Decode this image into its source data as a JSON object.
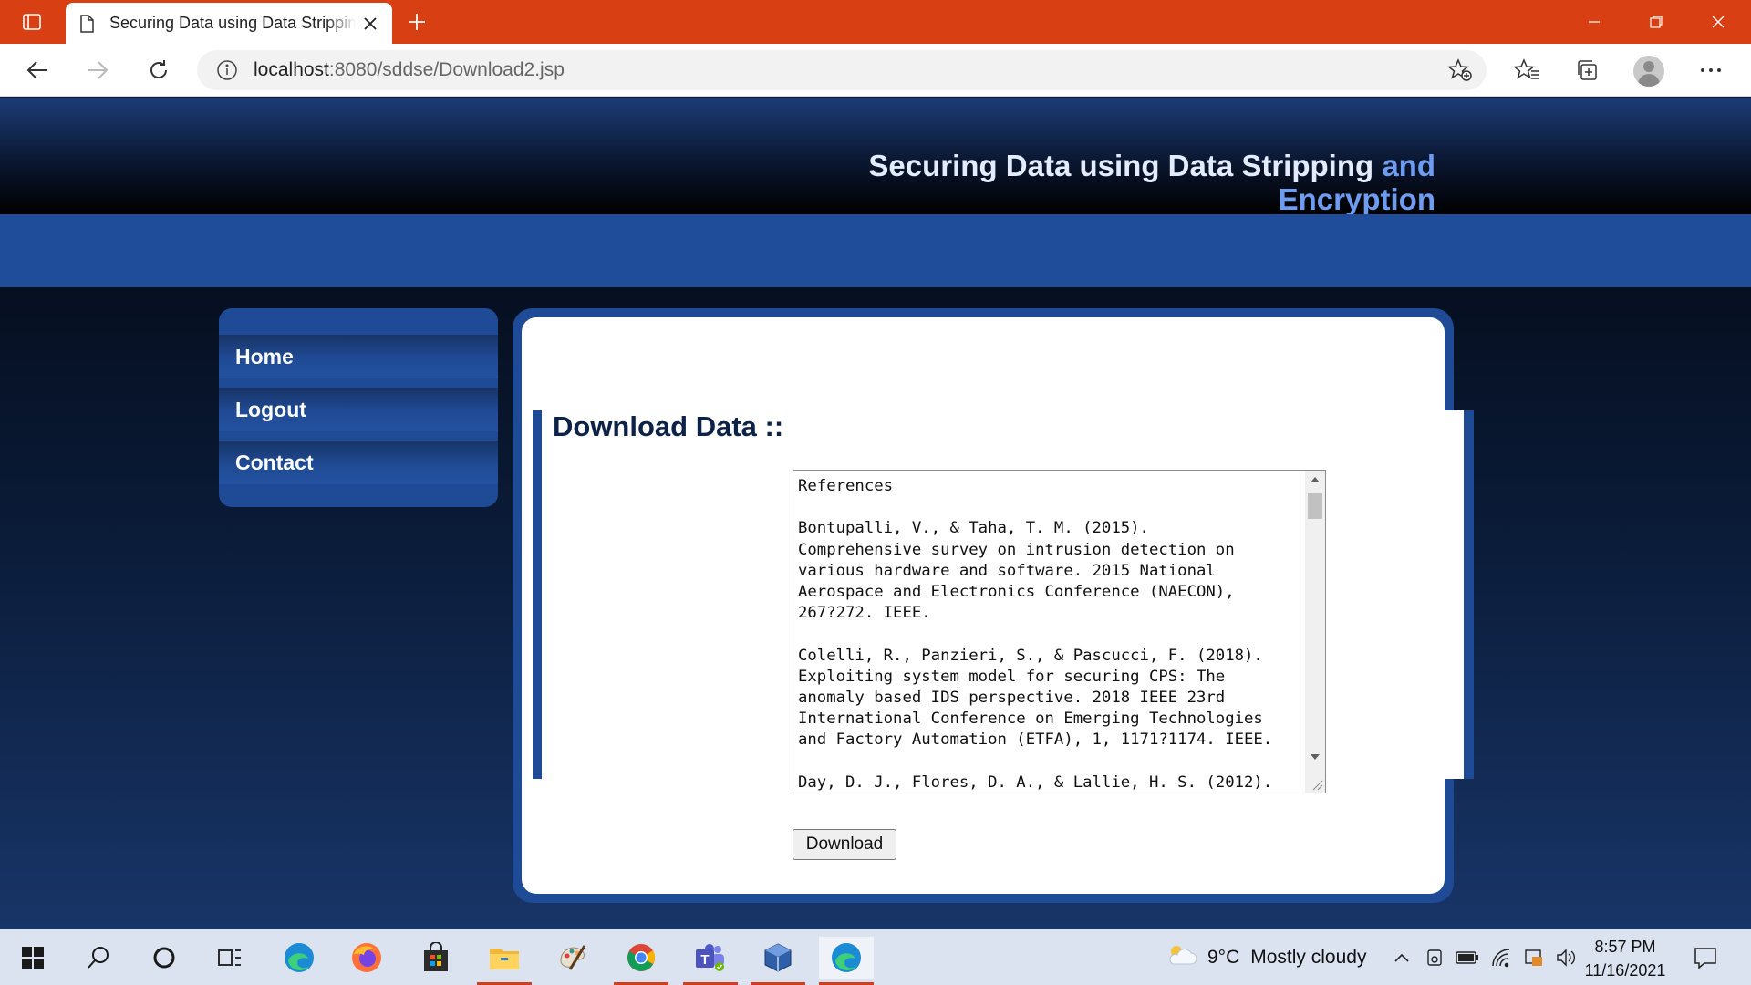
{
  "browser": {
    "tab_title": "Securing Data using Data Stripping and Encryption",
    "url_host": "localhost",
    "url_rest": ":8080/sddse/Download2.jsp"
  },
  "site": {
    "title_part1": "Securing Data using Data Stripping ",
    "title_part2": "and Encryption"
  },
  "sidebar": {
    "items": [
      {
        "label": "Home"
      },
      {
        "label": "Logout"
      },
      {
        "label": "Contact"
      }
    ]
  },
  "main": {
    "heading": "Download Data ::",
    "textarea_content": "References\n\nBontupalli, V., & Taha, T. M. (2015).\nComprehensive survey on intrusion detection on\nvarious hardware and software. 2015 National\nAerospace and Electronics Conference (NAECON),\n267?272. IEEE.\n\nColelli, R., Panzieri, S., & Pascucci, F. (2018).\nExploiting system model for securing CPS: The\nanomaly based IDS perspective. 2018 IEEE 23rd\nInternational Conference on Emerging Technologies\nand Factory Automation (ETFA), 1, 1171?1174. IEEE.\n\nDay, D. J., Flores, D. A., & Lallie, H. S. (2012).",
    "download_label": "Download"
  },
  "taskbar": {
    "weather_temp": "9°C",
    "weather_desc": "Mostly cloudy",
    "time": "8:57 PM",
    "date": "11/16/2021"
  },
  "colors": {
    "browser_accent": "#d84013",
    "page_blue": "#1f4a95",
    "heading": "#0d2248",
    "title_light": "#e3ecff",
    "title_accent": "#6d9cf0"
  }
}
